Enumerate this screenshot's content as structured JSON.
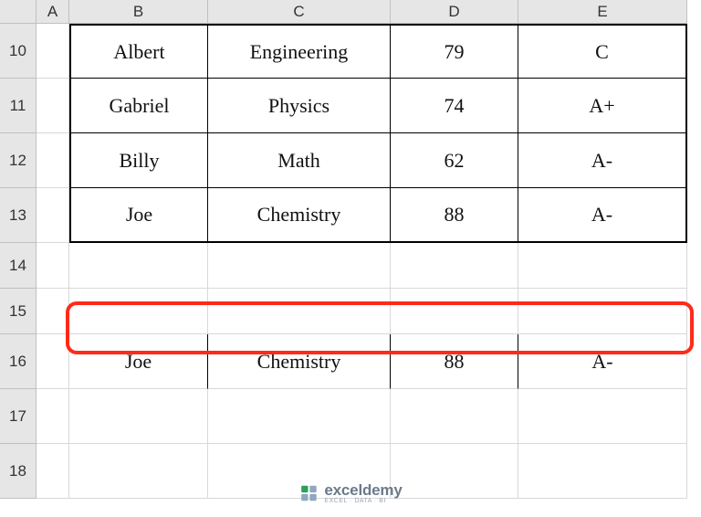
{
  "columns": {
    "A": "A",
    "B": "B",
    "C": "C",
    "D": "D",
    "E": "E"
  },
  "row_numbers": {
    "r10": "10",
    "r11": "11",
    "r12": "12",
    "r13": "13",
    "r14": "14",
    "r15": "15",
    "r16": "16",
    "r17": "17",
    "r18": "18"
  },
  "table": {
    "rows": [
      {
        "name": "Albert",
        "subject": "Engineering",
        "score": "79",
        "grade": "C"
      },
      {
        "name": "Gabriel",
        "subject": "Physics",
        "score": "74",
        "grade": "A+"
      },
      {
        "name": "Billy",
        "subject": "Math",
        "score": "62",
        "grade": "A-"
      },
      {
        "name": "Joe",
        "subject": "Chemistry",
        "score": "88",
        "grade": "A-"
      }
    ]
  },
  "result_row": {
    "name": "Joe",
    "subject": "Chemistry",
    "score": "88",
    "grade": "A-"
  },
  "watermark": {
    "main": "exceldemy",
    "sub": "EXCEL · DATA · BI"
  }
}
